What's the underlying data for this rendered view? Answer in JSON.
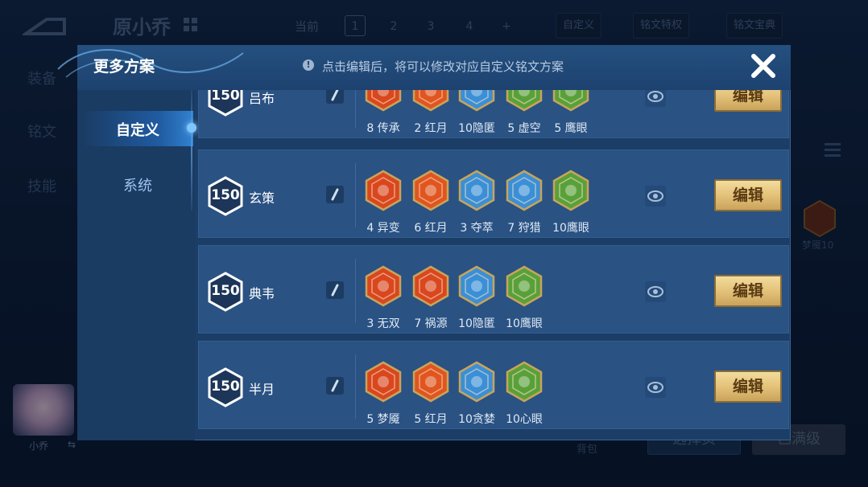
{
  "background": {
    "hero_name": "原小乔",
    "current_label": "当前",
    "page_tabs": [
      "1",
      "2",
      "3",
      "4",
      "+"
    ],
    "custom_button": "自定义",
    "privilege_button": "铭文特权",
    "treasure_button": "铭文宝典",
    "side_nav": [
      "装备",
      "铭文",
      "技能"
    ],
    "bg_gem_label": "梦魇10",
    "avatar_name": "小乔",
    "bag_label": "背包",
    "select_button": "选择页",
    "max_button": "已满级"
  },
  "modal": {
    "title": "更多方案",
    "tip": "点击编辑后，将可以修改对应自定义铭文方案",
    "nav": [
      "自定义",
      "系统"
    ],
    "rows": [
      {
        "level": "150",
        "name": "吕布",
        "gems": [
          {
            "label": "8 传承",
            "icon": "red-inherit-icon",
            "color": "#d9471f"
          },
          {
            "label": "2 红月",
            "icon": "red-moon-icon",
            "color": "#e05520"
          },
          {
            "label": "10隐匿",
            "icon": "blue-flame-icon",
            "color": "#3b8fd6"
          },
          {
            "label": "5 虚空",
            "icon": "green-void-icon",
            "color": "#5aa03a"
          },
          {
            "label": "5 鹰眼",
            "icon": "green-eagle-icon",
            "color": "#5aa03a"
          }
        ],
        "edit": "编辑"
      },
      {
        "level": "150",
        "name": "玄策",
        "gems": [
          {
            "label": "4 异变",
            "icon": "red-mutation-icon",
            "color": "#d9471f"
          },
          {
            "label": "6 红月",
            "icon": "red-moon-icon",
            "color": "#e05520"
          },
          {
            "label": "3 夺萃",
            "icon": "blue-knot-icon",
            "color": "#3b8fd6"
          },
          {
            "label": "7 狩猎",
            "icon": "blue-hunt-icon",
            "color": "#3b8fd6"
          },
          {
            "label": "10鹰眼",
            "icon": "green-eagle-icon",
            "color": "#5aa03a"
          }
        ],
        "edit": "编辑"
      },
      {
        "level": "150",
        "name": "典韦",
        "gems": [
          {
            "label": "3 无双",
            "icon": "red-peerless-icon",
            "color": "#d9471f"
          },
          {
            "label": "7 祸源",
            "icon": "red-calamity-icon",
            "color": "#d9471f"
          },
          {
            "label": "10隐匿",
            "icon": "blue-flame-icon",
            "color": "#3b8fd6"
          },
          {
            "label": "10鹰眼",
            "icon": "green-eagle-icon",
            "color": "#5aa03a"
          }
        ],
        "edit": "编辑"
      },
      {
        "level": "150",
        "name": "半月",
        "gems": [
          {
            "label": "5 梦魇",
            "icon": "red-nightmare-icon",
            "color": "#d9471f"
          },
          {
            "label": "5 红月",
            "icon": "red-moon-icon",
            "color": "#e05520"
          },
          {
            "label": "10贪婪",
            "icon": "blue-greed-icon",
            "color": "#3b8fd6"
          },
          {
            "label": "10心眼",
            "icon": "green-mind-eye-icon",
            "color": "#5aa03a"
          }
        ],
        "edit": "编辑"
      }
    ]
  }
}
